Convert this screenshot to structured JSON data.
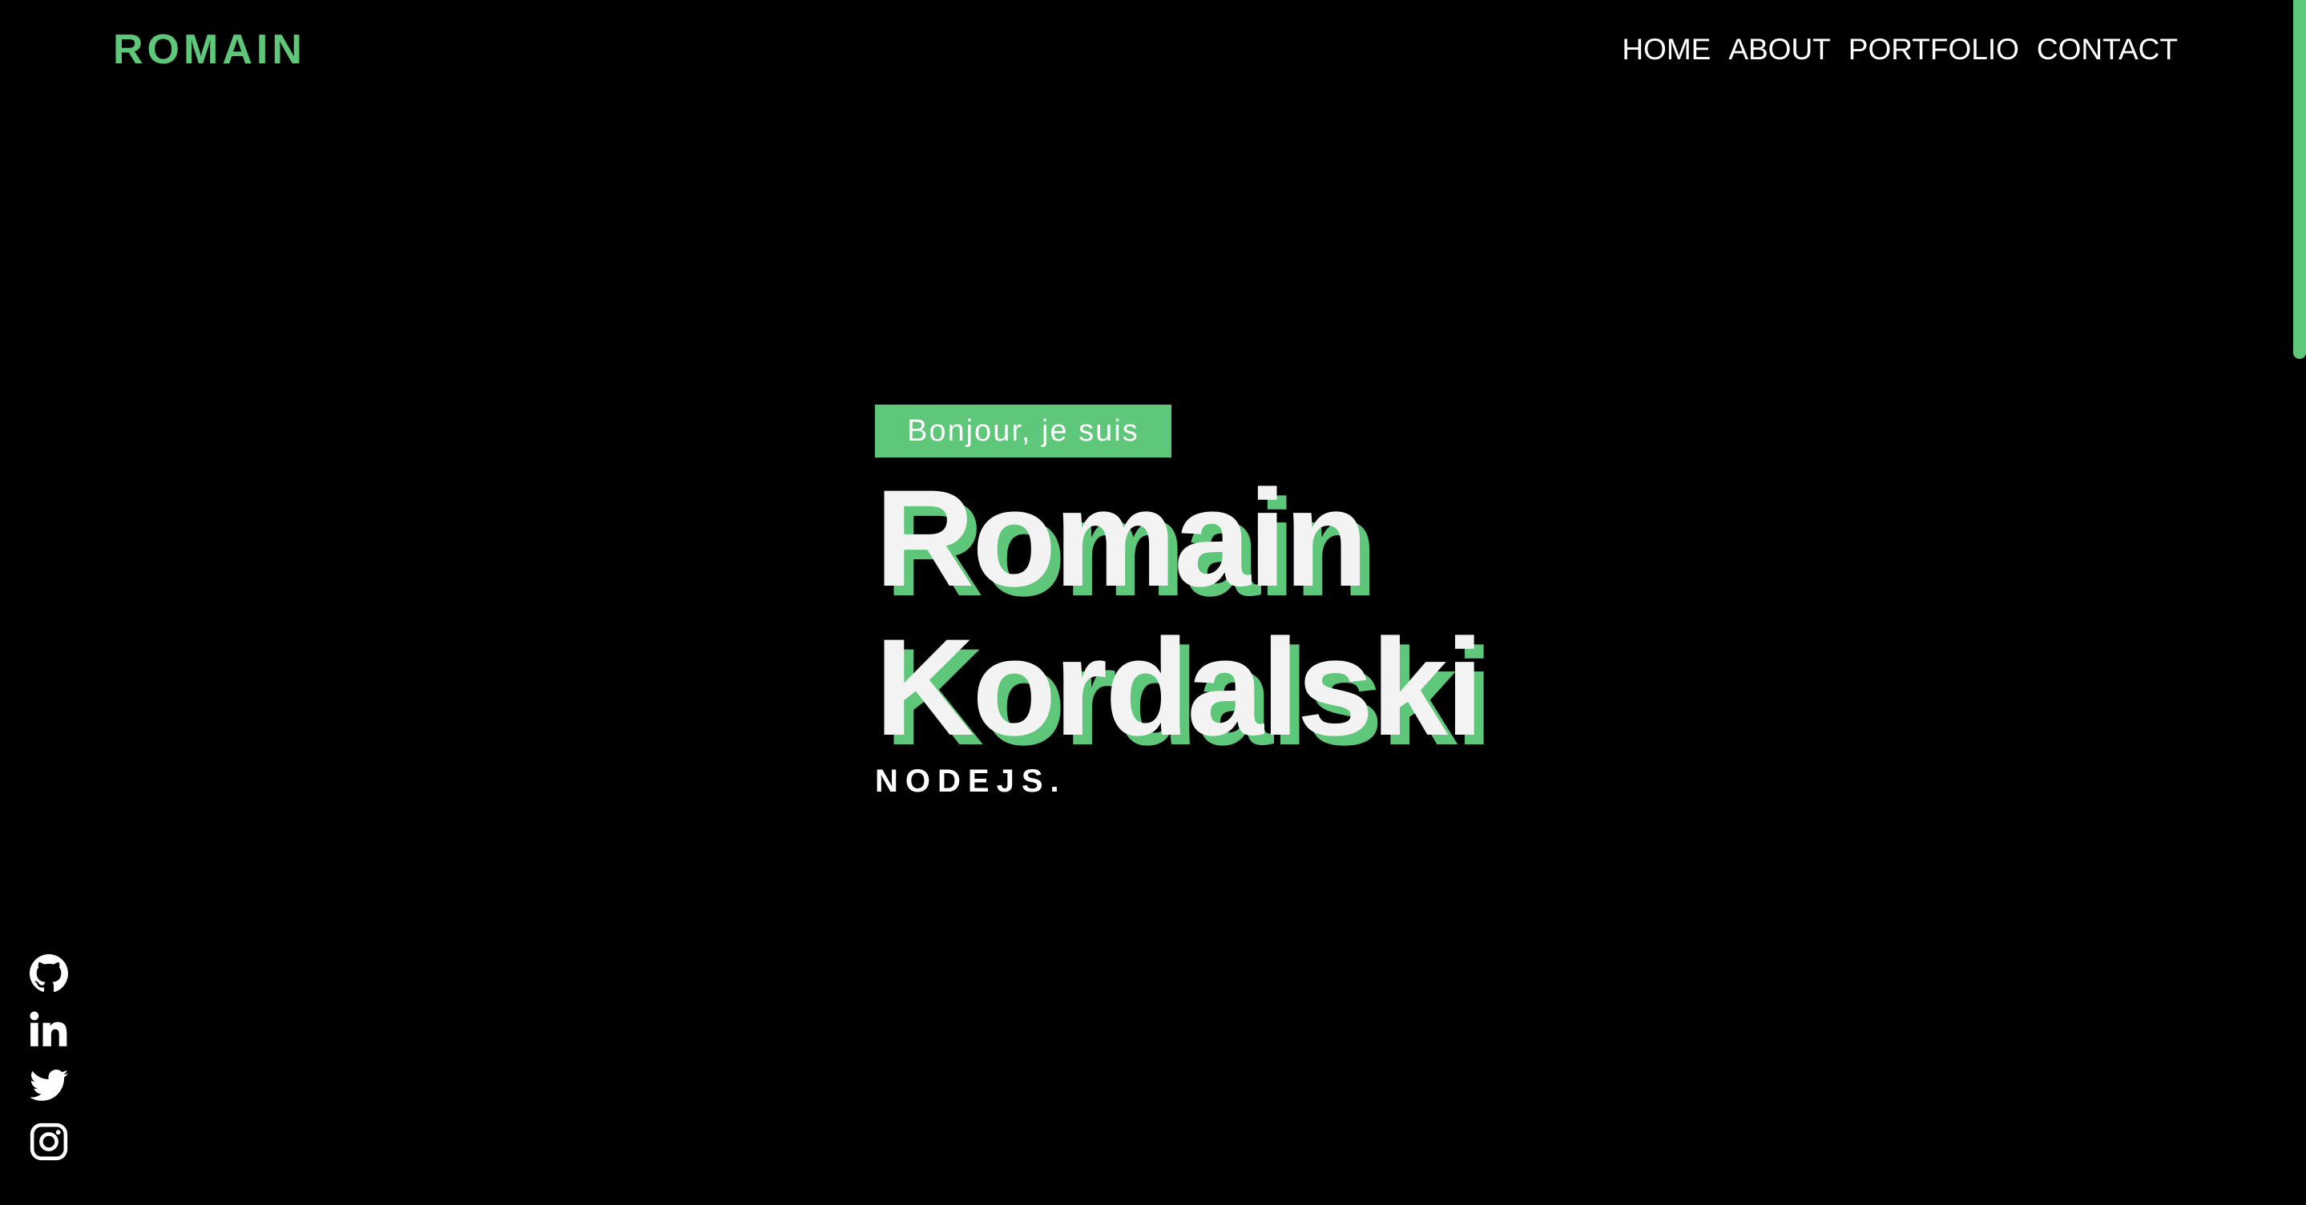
{
  "header": {
    "logo": "ROMAIN",
    "nav": [
      "HOME",
      "ABOUT",
      "PORTFOLIO",
      "CONTACT"
    ]
  },
  "hero": {
    "greeting": "Bonjour, je suis",
    "first_name": "Romain",
    "last_name": "Kordalski",
    "role": "NODEJS."
  },
  "socials": [
    "github-icon",
    "linkedin-icon",
    "twitter-icon",
    "instagram-icon"
  ],
  "colors": {
    "accent": "#5fc77a",
    "background": "#000000",
    "text": "#ffffff"
  }
}
